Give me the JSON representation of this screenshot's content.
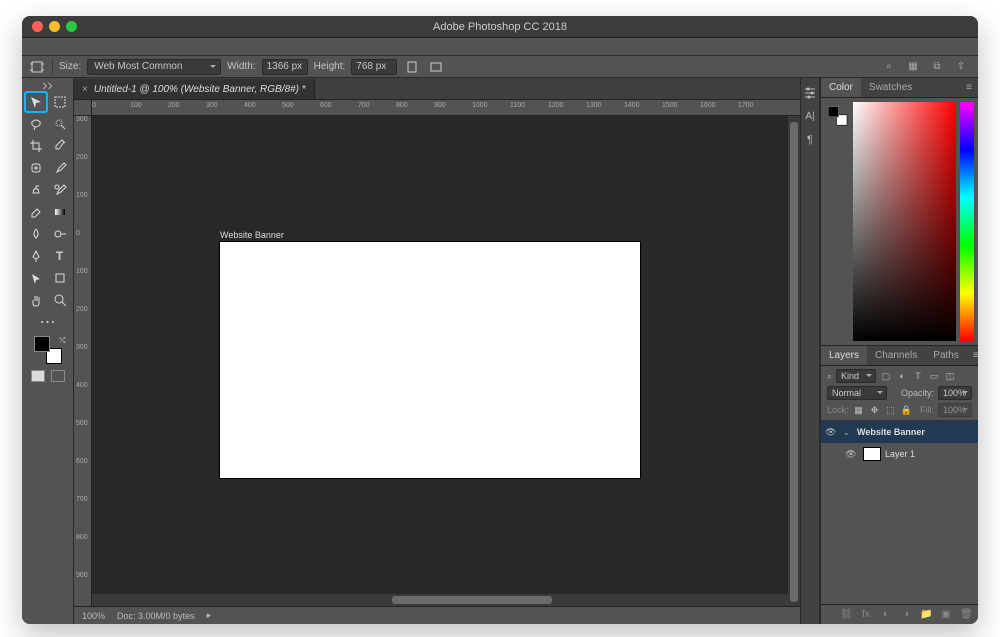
{
  "window": {
    "title": "Adobe Photoshop CC 2018"
  },
  "options_bar": {
    "size_label": "Size:",
    "preset": "Web Most Common",
    "width_label": "Width:",
    "width_value": "1366 px",
    "height_label": "Height:",
    "height_value": "768 px"
  },
  "document": {
    "tab_title": "Untitled-1 @ 100% (Website Banner, RGB/8#) *",
    "artboard_name": "Website Banner",
    "zoom": "100%",
    "doc_info": "Doc: 3.00M/0 bytes"
  },
  "ruler_h": [
    "0",
    "100",
    "200",
    "300",
    "400",
    "500",
    "600",
    "700",
    "800",
    "900",
    "1000",
    "1100",
    "1200",
    "1300",
    "1400",
    "1500",
    "1600",
    "1700"
  ],
  "ruler_v": [
    "300",
    "200",
    "100",
    "0",
    "100",
    "200",
    "300",
    "400",
    "500",
    "600",
    "700",
    "800",
    "900"
  ],
  "panels": {
    "color_tab": "Color",
    "swatches_tab": "Swatches",
    "layers_tab": "Layers",
    "channels_tab": "Channels",
    "paths_tab": "Paths",
    "kind_label": "Kind",
    "blend_mode": "Normal",
    "opacity_label": "Opacity:",
    "opacity_value": "100%",
    "lock_label": "Lock:",
    "fill_label": "Fill:",
    "fill_value": "100%"
  },
  "layers": [
    {
      "name": "Website Banner",
      "selected": true,
      "group": true
    },
    {
      "name": "Layer 1",
      "selected": false,
      "group": false
    }
  ],
  "strip_icons": [
    "sliders",
    "character",
    "paragraph"
  ],
  "icons": {
    "search": "⌕",
    "grid": "▦",
    "frame": "⧉",
    "share": "⇪",
    "menu": "≡",
    "eye": "👁",
    "link": "⛓",
    "fx": "fx",
    "mask": "◐",
    "adjust": "◑",
    "folder": "📁",
    "new": "▣",
    "trash": "🗑",
    "kind_img": "▢",
    "kind_adjust": "◐",
    "kind_type": "T",
    "kind_shape": "▭",
    "kind_smart": "◫"
  }
}
